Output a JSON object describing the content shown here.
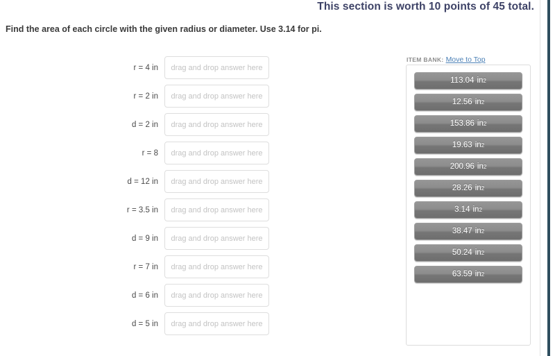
{
  "header": {
    "points_text": "This section is worth 10 points of 45 total."
  },
  "instruction": {
    "text": "Find the area of each circle with the given radius or diameter. Use 3.14 for pi."
  },
  "questions": {
    "dropzone_placeholder": "drag and drop answer here",
    "rows": [
      {
        "label": "r = 4 in",
        "answer": ""
      },
      {
        "label": "r = 2 in",
        "answer": ""
      },
      {
        "label": "d = 2 in",
        "answer": ""
      },
      {
        "label": "r = 8",
        "answer": ""
      },
      {
        "label": "d = 12 in",
        "answer": ""
      },
      {
        "label": "r = 3.5 in",
        "answer": ""
      },
      {
        "label": "d = 9 in",
        "answer": ""
      },
      {
        "label": "r = 7 in",
        "answer": ""
      },
      {
        "label": "d = 6 in",
        "answer": ""
      },
      {
        "label": "d = 5 in",
        "answer": ""
      }
    ]
  },
  "item_bank": {
    "title": "ITEM BANK:",
    "move_to_top_label": "Move to Top",
    "tiles": [
      {
        "value": "113.04",
        "unit": "in",
        "exponent": "2"
      },
      {
        "value": "12.56",
        "unit": "in",
        "exponent": "2"
      },
      {
        "value": "153.86",
        "unit": "in",
        "exponent": "2"
      },
      {
        "value": "19.63",
        "unit": "in",
        "exponent": "2"
      },
      {
        "value": "200.96",
        "unit": "in",
        "exponent": "2"
      },
      {
        "value": "28.26",
        "unit": "in",
        "exponent": "2"
      },
      {
        "value": "3.14",
        "unit": "in",
        "exponent": "2"
      },
      {
        "value": "38.47",
        "unit": "in",
        "exponent": "2"
      },
      {
        "value": "50.24",
        "unit": "in",
        "exponent": "2"
      },
      {
        "value": "63.59",
        "unit": "in",
        "exponent": "2"
      }
    ]
  },
  "colors": {
    "header_navy": "#3d4266",
    "link_blue": "#4a7fb5",
    "tile_gray_top": "#969696",
    "tile_gray_bottom": "#6e6e6e",
    "edge_band_teal": "#2e4e5e",
    "placeholder_gray": "#c3c3c3"
  }
}
